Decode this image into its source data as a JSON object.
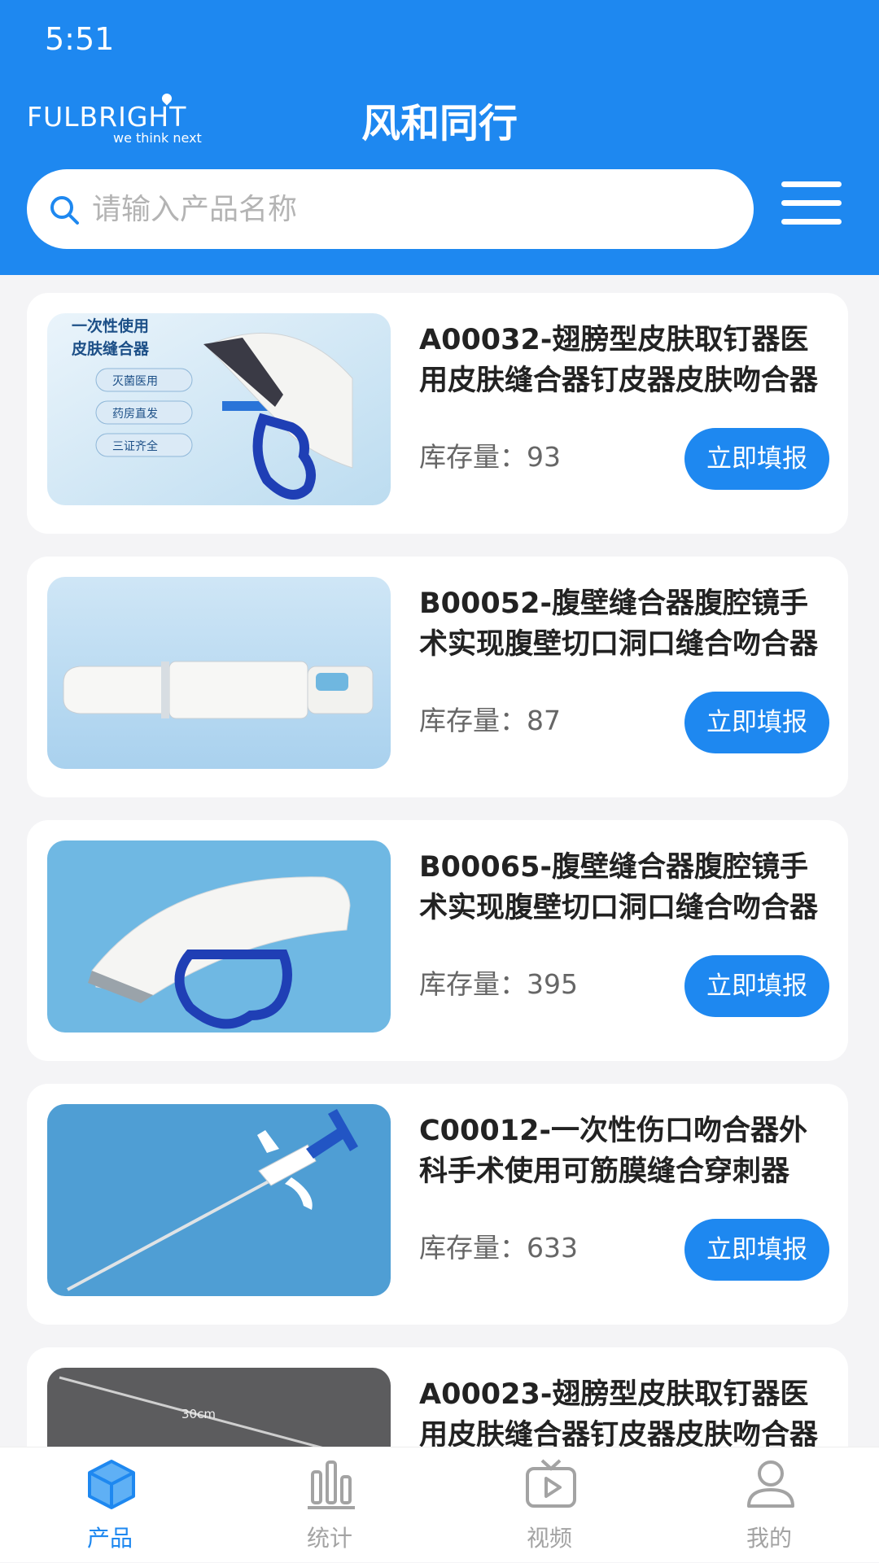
{
  "status_bar": {
    "time": "5:51"
  },
  "header": {
    "logo_text": "FULBRIGHT",
    "logo_tagline": "we think next",
    "title": "风和同行"
  },
  "search": {
    "placeholder": "请输入产品名称",
    "value": ""
  },
  "products": [
    {
      "name": "A00032-翅膀型皮肤取钉器医用皮肤缝合器钉皮器皮肤吻合器",
      "stock_label": "库存量：93",
      "button": "立即填报",
      "image_caption_lines": [
        "一次性使用",
        "皮肤缝合器"
      ],
      "image_badges": [
        "灭菌医用",
        "药房直发",
        "三证齐全"
      ]
    },
    {
      "name": "B00052-腹壁缝合器腹腔镜手术实现腹壁切口洞口缝合吻合器",
      "stock_label": "库存量：87",
      "button": "立即填报"
    },
    {
      "name": "B00065-腹壁缝合器腹腔镜手术实现腹壁切口洞口缝合吻合器",
      "stock_label": "库存量：395",
      "button": "立即填报"
    },
    {
      "name": "C00012-一次性伤口吻合器外科手术使用可筋膜缝合穿刺器",
      "stock_label": "库存量：633",
      "button": "立即填报"
    },
    {
      "name": "A00023-翅膀型皮肤取钉器医用皮肤缝合器钉皮器皮肤吻合器",
      "stock_label": "",
      "button": "",
      "image_text": "30cm"
    }
  ],
  "tabbar": [
    {
      "label": "产品",
      "icon": "cube-icon",
      "active": true
    },
    {
      "label": "统计",
      "icon": "bar-chart-icon",
      "active": false
    },
    {
      "label": "视频",
      "icon": "tv-play-icon",
      "active": false
    },
    {
      "label": "我的",
      "icon": "user-icon",
      "active": false
    }
  ],
  "colors": {
    "primary": "#1e88f0",
    "background": "#f4f4f6",
    "inactive_tab": "#a3a3a3"
  }
}
